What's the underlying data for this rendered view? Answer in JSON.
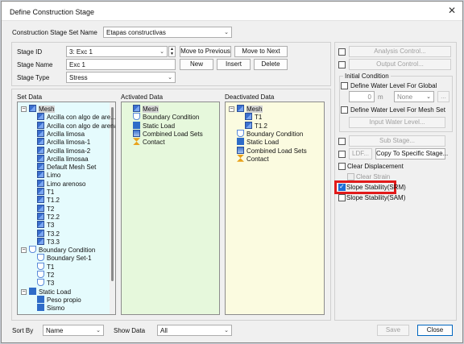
{
  "window": {
    "title": "Define Construction Stage"
  },
  "stage_set": {
    "label": "Construction Stage Set Name",
    "value": "Etapas constructivas"
  },
  "stage": {
    "id_label": "Stage ID",
    "id_value": "3: Exc 1",
    "name_label": "Stage Name",
    "name_value": "Exc 1",
    "type_label": "Stage Type",
    "type_value": "Stress"
  },
  "buttons": {
    "move_prev": "Move to Previous",
    "move_next": "Move to Next",
    "new": "New",
    "insert": "Insert",
    "delete": "Delete",
    "save": "Save",
    "close": "Close"
  },
  "panels": {
    "set_data": "Set Data",
    "activated": "Activated Data",
    "deactivated": "Deactivated Data"
  },
  "set_tree": [
    {
      "label": "Mesh",
      "icon": "mesh",
      "level": 0,
      "toggle": "−",
      "hl": true
    },
    {
      "label": "Arcilla con algo de are...",
      "icon": "mesh",
      "level": 1
    },
    {
      "label": "Arcilla con algo de arena",
      "icon": "mesh",
      "level": 1
    },
    {
      "label": "Arcilla limosa",
      "icon": "mesh",
      "level": 1
    },
    {
      "label": "Arcilla limosa-1",
      "icon": "mesh",
      "level": 1
    },
    {
      "label": "Arcilla limosa-2",
      "icon": "mesh",
      "level": 1
    },
    {
      "label": "Arcilla limosaa",
      "icon": "mesh",
      "level": 1
    },
    {
      "label": "Default Mesh Set",
      "icon": "mesh",
      "level": 1
    },
    {
      "label": "Limo",
      "icon": "mesh",
      "level": 1
    },
    {
      "label": "Limo arenoso",
      "icon": "mesh",
      "level": 1
    },
    {
      "label": "T1",
      "icon": "mesh",
      "level": 1
    },
    {
      "label": "T1.2",
      "icon": "mesh",
      "level": 1
    },
    {
      "label": "T2",
      "icon": "mesh",
      "level": 1
    },
    {
      "label": "T2.2",
      "icon": "mesh",
      "level": 1
    },
    {
      "label": "T3",
      "icon": "mesh",
      "level": 1
    },
    {
      "label": "T3.2",
      "icon": "mesh",
      "level": 1
    },
    {
      "label": "T3.3",
      "icon": "mesh",
      "level": 1
    },
    {
      "label": "Boundary Condition",
      "icon": "bc",
      "level": 0,
      "toggle": "−"
    },
    {
      "label": "Boundary Set-1",
      "icon": "bc",
      "level": 1
    },
    {
      "label": "T1",
      "icon": "bc",
      "level": 1
    },
    {
      "label": "T2",
      "icon": "bc",
      "level": 1
    },
    {
      "label": "T3",
      "icon": "bc",
      "level": 1
    },
    {
      "label": "Static Load",
      "icon": "load",
      "level": 0,
      "toggle": "−"
    },
    {
      "label": "Peso propio",
      "icon": "load",
      "level": 1
    },
    {
      "label": "Sismo",
      "icon": "load",
      "level": 1
    }
  ],
  "activated_tree": [
    {
      "label": "Mesh",
      "icon": "mesh",
      "level": 0,
      "hl": true
    },
    {
      "label": "Boundary Condition",
      "icon": "bc",
      "level": 0
    },
    {
      "label": "Static Load",
      "icon": "load",
      "level": 0
    },
    {
      "label": "Combined Load Sets",
      "icon": "cls",
      "level": 0
    },
    {
      "label": "Contact",
      "icon": "contact",
      "level": 0
    }
  ],
  "deactivated_tree": [
    {
      "label": "Mesh",
      "icon": "mesh",
      "level": 0,
      "toggle": "−",
      "hl": true
    },
    {
      "label": "T1",
      "icon": "mesh",
      "level": 1
    },
    {
      "label": "T1.2",
      "icon": "mesh",
      "level": 1
    },
    {
      "label": "Boundary Condition",
      "icon": "bc",
      "level": 0
    },
    {
      "label": "Static Load",
      "icon": "load",
      "level": 0
    },
    {
      "label": "Combined Load Sets",
      "icon": "cls",
      "level": 0
    },
    {
      "label": "Contact",
      "icon": "contact",
      "level": 0
    }
  ],
  "right": {
    "analysis_control": "Analysis Control...",
    "output_control": "Output Control...",
    "initial_condition": "Initial Condition",
    "define_wl_global": "Define Water Level For Global",
    "wl_value": "0",
    "wl_unit": "m",
    "wl_select": "None",
    "ellipsis": "...",
    "define_wl_mesh": "Define Water Level For Mesh Set",
    "input_wl": "Input Water Level...",
    "sub_stage": "Sub Stage...",
    "ldf": "LDF...",
    "copy_stage": "Copy To Specific Stage...",
    "clear_disp": "Clear Displacement",
    "clear_strain": "Clear Strain",
    "slope_srm": "Slope Stability(SRM)",
    "slope_sam": "Slope Stability(SAM)"
  },
  "footer": {
    "sort_by_label": "Sort By",
    "sort_by_value": "Name",
    "show_data_label": "Show Data",
    "show_data_value": "All"
  },
  "colors": {
    "highlight": "#e11a1a",
    "activated_bg": "#e6f8dc",
    "deactivated_bg": "#fbfbe0",
    "set_bg": "#e5fbfd"
  }
}
